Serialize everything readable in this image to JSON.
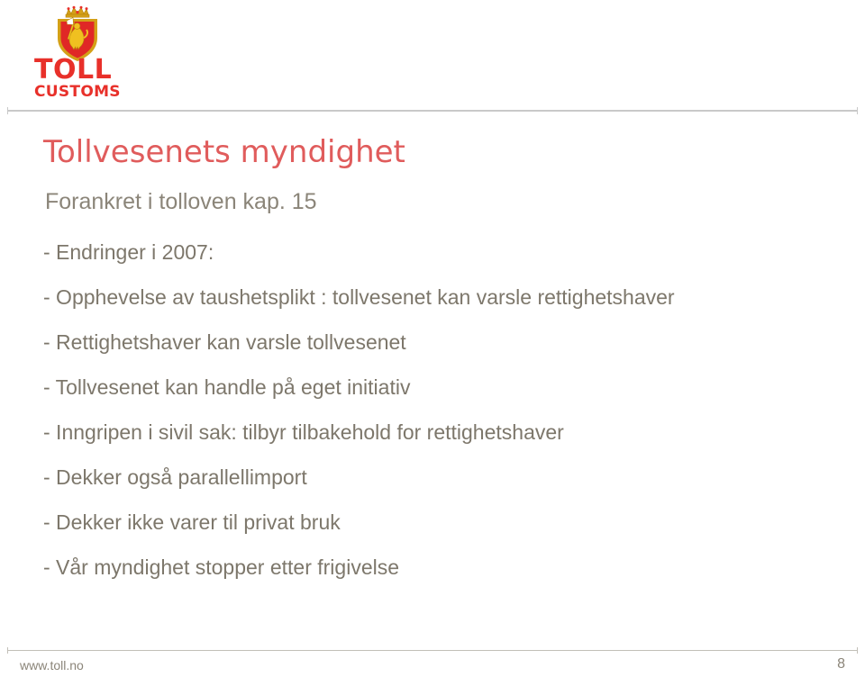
{
  "brand": {
    "logo_icon": "norwegian-customs-crest-icon",
    "wordmark_primary": "TOLL",
    "wordmark_secondary": "CUSTOMS",
    "brand_red": "#e8302a"
  },
  "slide": {
    "title": "Tollvesenets myndighet",
    "title_color": "#e05c5c",
    "subtitle": "Forankret i tolloven kap. 15",
    "subtitle_color": "#8b8579",
    "body_color": "#7d776b",
    "bullets": [
      "- Endringer i 2007:",
      "- Opphevelse av taushetsplikt : tollvesenet kan varsle rettighetshaver",
      "- Rettighetshaver kan varsle tollvesenet",
      "- Tollvesenet kan handle på eget initiativ",
      "- Inngripen i sivil sak: tilbyr tilbakehold for rettighetshaver",
      "- Dekker også parallellimport",
      "- Dekker ikke varer til privat bruk",
      "- Vår myndighet stopper etter frigivelse"
    ]
  },
  "footer": {
    "url": "www.toll.no",
    "page_number": "8"
  }
}
